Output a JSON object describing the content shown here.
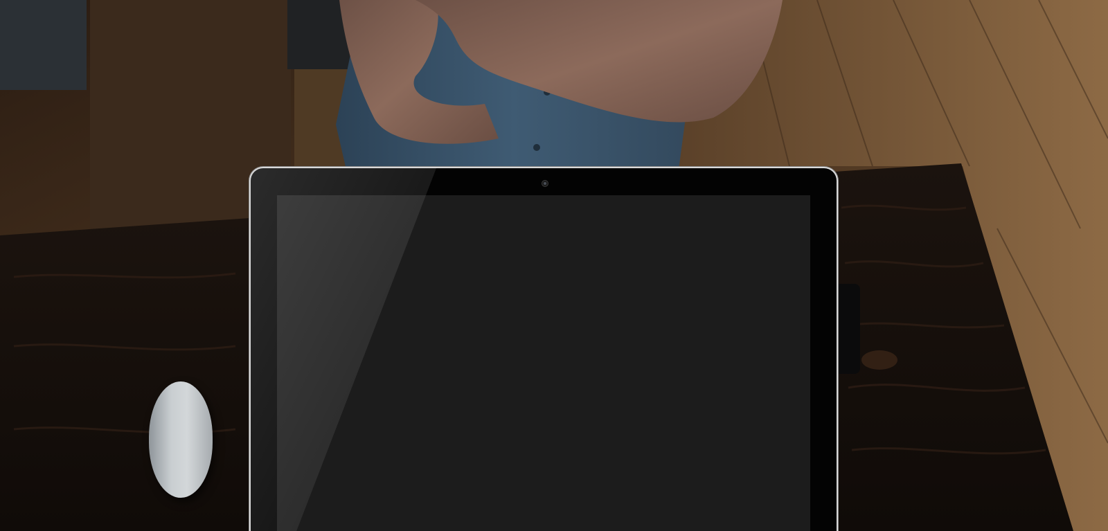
{
  "scene": {
    "description_free": true,
    "colors": {
      "floor_wood": "#6b4a2a",
      "desk_dark": "#1a120e",
      "shirt_denim": "#3f5b73",
      "skin": "#8e6a5a",
      "bezel": "#030303",
      "screen": "#1c1c1c",
      "monitor_rim": "#d8d8d8",
      "mouse": "#c9ced1"
    },
    "icons": [
      "camera-icon"
    ]
  }
}
